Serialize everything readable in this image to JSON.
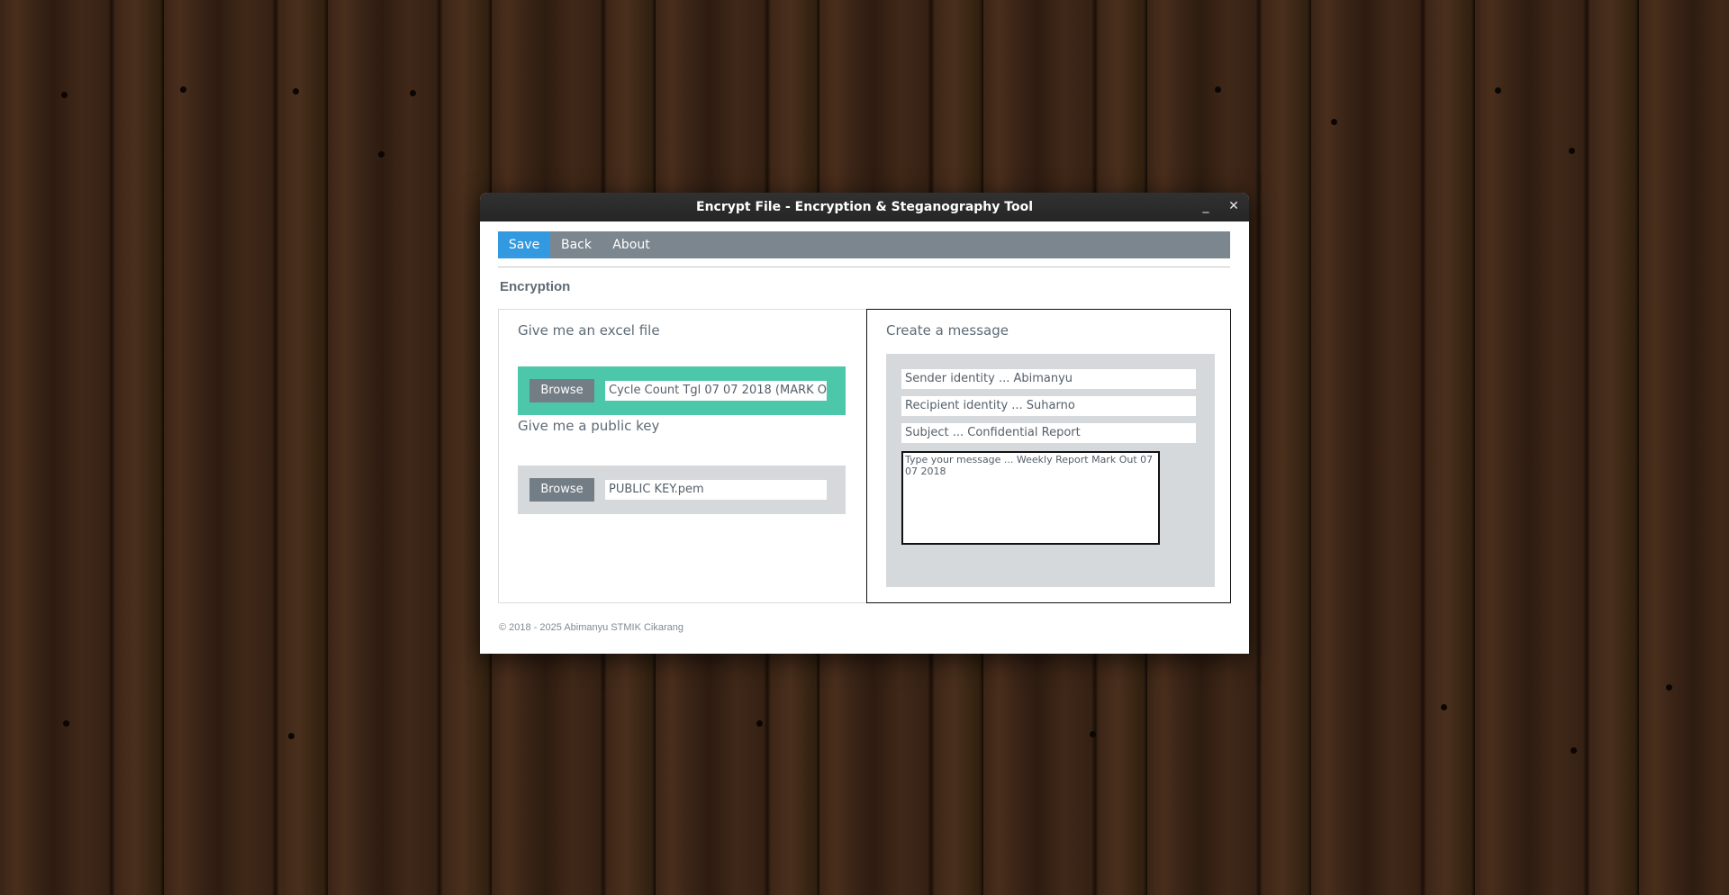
{
  "window": {
    "title": "Encrypt File - Encryption & Steganography Tool",
    "minimize_glyph": "_",
    "close_glyph": "✕"
  },
  "menu": {
    "items": [
      {
        "label": "Save",
        "active": true
      },
      {
        "label": "Back",
        "active": false
      },
      {
        "label": "About",
        "active": false
      }
    ]
  },
  "section_heading": "Encryption",
  "left_panel": {
    "excel": {
      "title": "Give me an excel file",
      "button_label": "Browse",
      "value": "Cycle Count Tgl 07 07 2018 (MARK O"
    },
    "public_key": {
      "title": "Give me a public key",
      "button_label": "Browse",
      "value": "PUBLIC KEY.pem"
    }
  },
  "right_panel": {
    "title": "Create a message",
    "sender": "Sender identity ... Abimanyu",
    "recipient": "Recipient identity ... Suharno",
    "subject": "Subject ... Confidential Report",
    "message": "Type your message ... Weekly Report Mark Out 07 07 2018"
  },
  "footer": "© 2018 - 2025 Abimanyu STMIK Cikarang",
  "colors": {
    "menu_bar": "#7b868f",
    "menu_active": "#3399e0",
    "excel_row": "#4cc7aa",
    "key_row": "#d6d9db",
    "button": "#737d85"
  }
}
